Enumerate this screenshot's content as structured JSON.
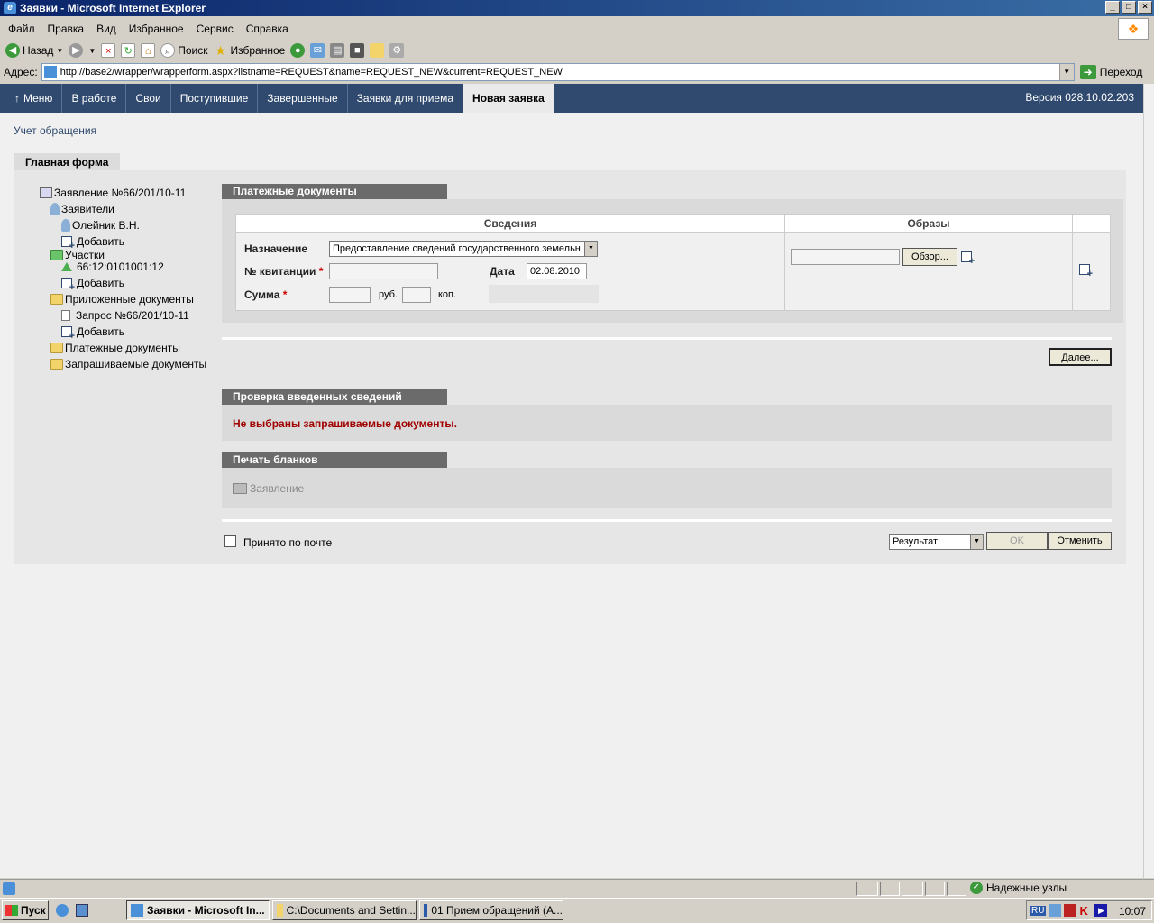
{
  "window": {
    "title": "Заявки - Microsoft Internet Explorer"
  },
  "menubar": [
    "Файл",
    "Правка",
    "Вид",
    "Избранное",
    "Сервис",
    "Справка"
  ],
  "toolbar": {
    "back": "Назад",
    "search": "Поиск",
    "favorites": "Избранное"
  },
  "address": {
    "label": "Адрес:",
    "url": "http://base2/wrapper/wrapperform.aspx?listname=REQUEST&name=REQUEST_NEW&current=REQUEST_NEW",
    "go": "Переход"
  },
  "appnav": {
    "items": [
      "Меню",
      "В работе",
      "Свои",
      "Поступившие",
      "Завершенные",
      "Заявки для приема",
      "Новая заявка"
    ],
    "version": "Версия 028.10.02.203"
  },
  "page": {
    "title": "Учет обращения",
    "tab": "Главная форма"
  },
  "tree": {
    "root": "Заявление №66/201/10-11",
    "applicants": "Заявители",
    "applicant1": "Олейник В.Н.",
    "add1": "Добавить",
    "plots": "Участки",
    "plot1": "66:12:0101001:12",
    "add2": "Добавить",
    "attached": "Приложенные документы",
    "request": "Запрос №66/201/10-11",
    "add3": "Добавить",
    "payment": "Платежные документы",
    "requested": "Запрашиваемые документы"
  },
  "payment": {
    "header": "Платежные документы",
    "col_info": "Сведения",
    "col_images": "Образы",
    "purpose_label": "Назначение",
    "purpose_value": "Предоставление сведений государственного земельн",
    "receipt_label": "№ квитанции",
    "date_label": "Дата",
    "date_value": "02.08.2010",
    "sum_label": "Сумма",
    "rub": "руб.",
    "kop": "коп.",
    "browse": "Обзор...",
    "required_mark": "*"
  },
  "next_button": "Далее...",
  "check": {
    "header": "Проверка введенных сведений",
    "message": "Не выбраны запрашиваемые документы."
  },
  "print": {
    "header": "Печать бланков",
    "item": "Заявление"
  },
  "footer": {
    "mail_label": "Принято по почте",
    "result_value": "Результат:",
    "ok": "OK",
    "cancel": "Отменить"
  },
  "status": {
    "zone": "Надежные узлы"
  },
  "taskbar": {
    "start": "Пуск",
    "items": [
      "Заявки - Microsoft In...",
      "C:\\Documents and Settin...",
      "01 Прием обращений (А..."
    ],
    "lang": "RU",
    "clock": "10:07"
  },
  "colors": {
    "nav_bg": "#2f4a6e",
    "section_head": "#6b6b6b",
    "error_text": "#a00000"
  }
}
